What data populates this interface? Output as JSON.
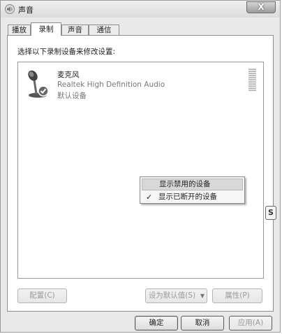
{
  "window": {
    "title": "声音",
    "close_label": "X"
  },
  "tabs": [
    {
      "label": "播放",
      "active": false
    },
    {
      "label": "录制",
      "active": true
    },
    {
      "label": "声音",
      "active": false
    },
    {
      "label": "通信",
      "active": false
    }
  ],
  "panel": {
    "instruction": "选择以下录制设备来修改设置:"
  },
  "device": {
    "name": "麦克风",
    "driver": "Realtek High Definition Audio",
    "status": "默认设备"
  },
  "context_menu": {
    "items": [
      {
        "label": "显示禁用的设备",
        "checked": false
      },
      {
        "label": "显示已断开的设备",
        "checked": true
      }
    ],
    "check_glyph": "✓"
  },
  "buttons": {
    "configure": "配置(C)",
    "set_default": "设为默认值(S)",
    "properties": "属性(P)",
    "ok": "确定",
    "cancel": "取消",
    "apply": "应用(A)"
  },
  "side_badge": "S",
  "icons": {
    "window": "speaker-icon",
    "device": "microphone-icon",
    "default_marker": "green-check-icon"
  },
  "colors": {
    "check_green": "#2e9e2e"
  }
}
